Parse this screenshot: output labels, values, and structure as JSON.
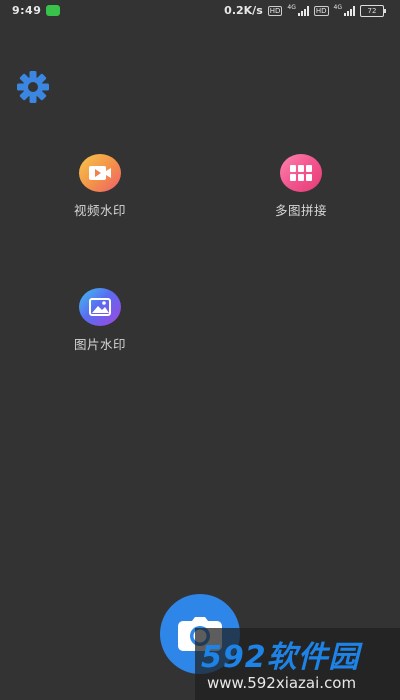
{
  "status": {
    "time": "9:49",
    "speed": "0.2K/s",
    "hd": "HD",
    "net1": "4G",
    "net2": "4G",
    "battery": "72"
  },
  "settings": {
    "icon": "gear-icon",
    "color": "#3a86e0"
  },
  "features": {
    "video_watermark": {
      "label": "视频水印",
      "icon": "video-camera-icon"
    },
    "collage": {
      "label": "多图拼接",
      "icon": "grid-icon"
    },
    "image_watermark": {
      "label": "图片水印",
      "icon": "image-icon"
    }
  },
  "camera": {
    "icon": "camera-icon",
    "color": "#2e86e8"
  },
  "watermark": {
    "brand": "592软件园",
    "url": "www.592xiazai.com"
  }
}
